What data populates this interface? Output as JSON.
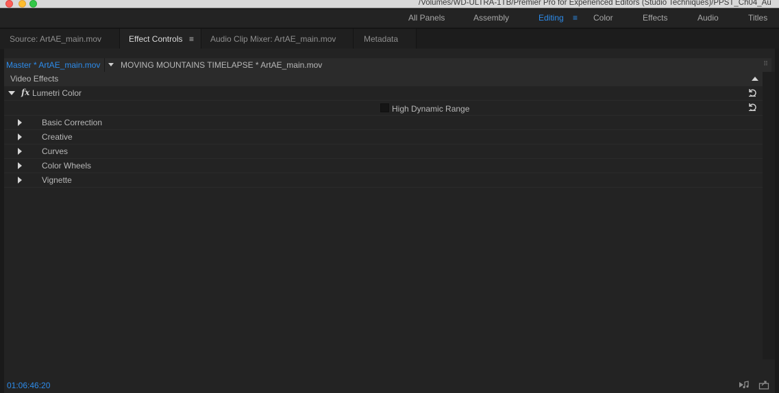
{
  "window": {
    "title": "/Volumes/WD-ULTRA-1TB/Premier Pro for Experienced Editors (Studio Techniques)/PPST_Ch04_Au"
  },
  "workspaces": {
    "items": [
      {
        "label": "All Panels"
      },
      {
        "label": "Assembly"
      },
      {
        "label": "Editing",
        "active": true
      },
      {
        "label": "Color"
      },
      {
        "label": "Effects"
      },
      {
        "label": "Audio"
      },
      {
        "label": "Titles"
      }
    ],
    "menu_glyph": "≡"
  },
  "panel_tabs": {
    "items": [
      {
        "label": "Source: ArtAE_main.mov"
      },
      {
        "label": "Effect Controls",
        "active": true
      },
      {
        "label": "Audio Clip Mixer: ArtAE_main.mov"
      },
      {
        "label": "Metadata"
      }
    ],
    "menu_glyph": "≡"
  },
  "effect_controls": {
    "master_clip": "Master * ArtAE_main.mov",
    "sequence_clip": "MOVING MOUNTAINS TIMELAPSE * ArtAE_main.mov",
    "section_header": "Video Effects",
    "effect": {
      "name": "Lumetri Color",
      "fx_glyph": "fx",
      "hdr_label": "High Dynamic Range",
      "groups": [
        {
          "label": "Basic Correction"
        },
        {
          "label": "Creative"
        },
        {
          "label": "Curves"
        },
        {
          "label": "Color Wheels"
        },
        {
          "label": "Vignette"
        }
      ]
    },
    "timecode": "01:06:46:20"
  },
  "colors": {
    "accent": "#2d8ceb",
    "panel_bg": "#232323",
    "header_bg": "#2b2b2b"
  },
  "icons": [
    "reset-icon",
    "play-audio-icon",
    "export-icon",
    "menu-icon",
    "disclosure-triangle-icon"
  ]
}
